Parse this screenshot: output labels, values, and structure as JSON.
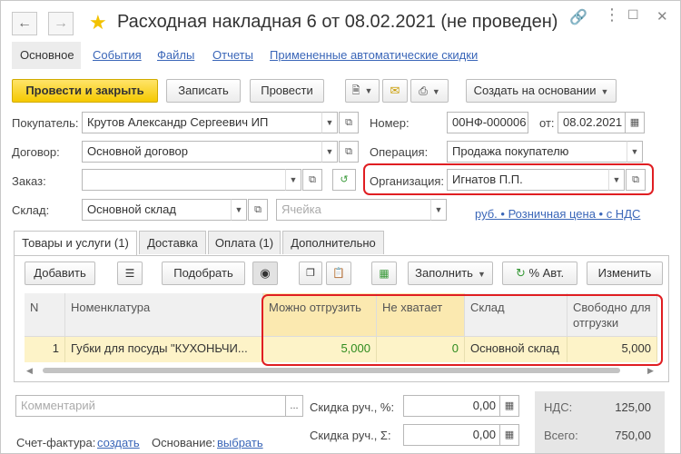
{
  "window": {
    "title": "Расходная накладная 6 от 08.02.2021 (не проведен)"
  },
  "nav_tabs": [
    {
      "label": "Основное"
    },
    {
      "label": "События"
    },
    {
      "label": "Файлы"
    },
    {
      "label": "Отчеты"
    },
    {
      "label": "Примененные автоматические скидки"
    }
  ],
  "toolbar": {
    "post_close": "Провести и закрыть",
    "save": "Записать",
    "post": "Провести",
    "create_based": "Создать на основании"
  },
  "form": {
    "buyer_label": "Покупатель:",
    "buyer_value": "Крутов Александр Сергеевич ИП",
    "number_label": "Номер:",
    "number_value": "00НФ-000006",
    "date_label": "от:",
    "date_value": "08.02.2021",
    "contract_label": "Договор:",
    "contract_value": "Основной договор",
    "operation_label": "Операция:",
    "operation_value": "Продажа покупателю",
    "order_label": "Заказ:",
    "order_value": "",
    "org_label": "Организация:",
    "org_value": "Игнатов П.П.",
    "warehouse_label": "Склад:",
    "warehouse_value": "Основной склад",
    "cell_placeholder": "Ячейка",
    "price_link": "руб. • Розничная цена • с НДС"
  },
  "sub_tabs": [
    {
      "label": "Товары и услуги (1)"
    },
    {
      "label": "Доставка"
    },
    {
      "label": "Оплата (1)"
    },
    {
      "label": "Дополнительно"
    }
  ],
  "table_toolbar": {
    "add": "Добавить",
    "pick": "Подобрать",
    "fill": "Заполнить",
    "percent_auto": "% Авт.",
    "change": "Изменить"
  },
  "table": {
    "columns": [
      "N",
      "Номенклатура",
      "Можно отгрузить",
      "Не хватает",
      "Склад",
      "Свободно для отгрузки"
    ],
    "rows": [
      [
        "1",
        "Губки для посуды \"КУХОНЬЧИ...",
        "5,000",
        "0",
        "Основной склад",
        "5,000"
      ]
    ]
  },
  "footer": {
    "comment_placeholder": "Комментарий",
    "discount_pct_label": "Скидка руч., %:",
    "discount_pct_value": "0,00",
    "discount_sum_label": "Скидка руч., Σ:",
    "discount_sum_value": "0,00",
    "vat_label": "НДС:",
    "vat_value": "125,00",
    "total_label": "Всего:",
    "total_value": "750,00",
    "invoice_label": "Счет-фактура:",
    "invoice_link": "создать",
    "basis_label": "Основание:",
    "basis_link": "выбрать"
  },
  "colors": {
    "accent_yellow": "#f5c900",
    "highlight_red": "#e01e22",
    "link_blue": "#3a66b8",
    "row_highlight": "#fdf3c8",
    "positive_green": "#2e8b1e"
  }
}
